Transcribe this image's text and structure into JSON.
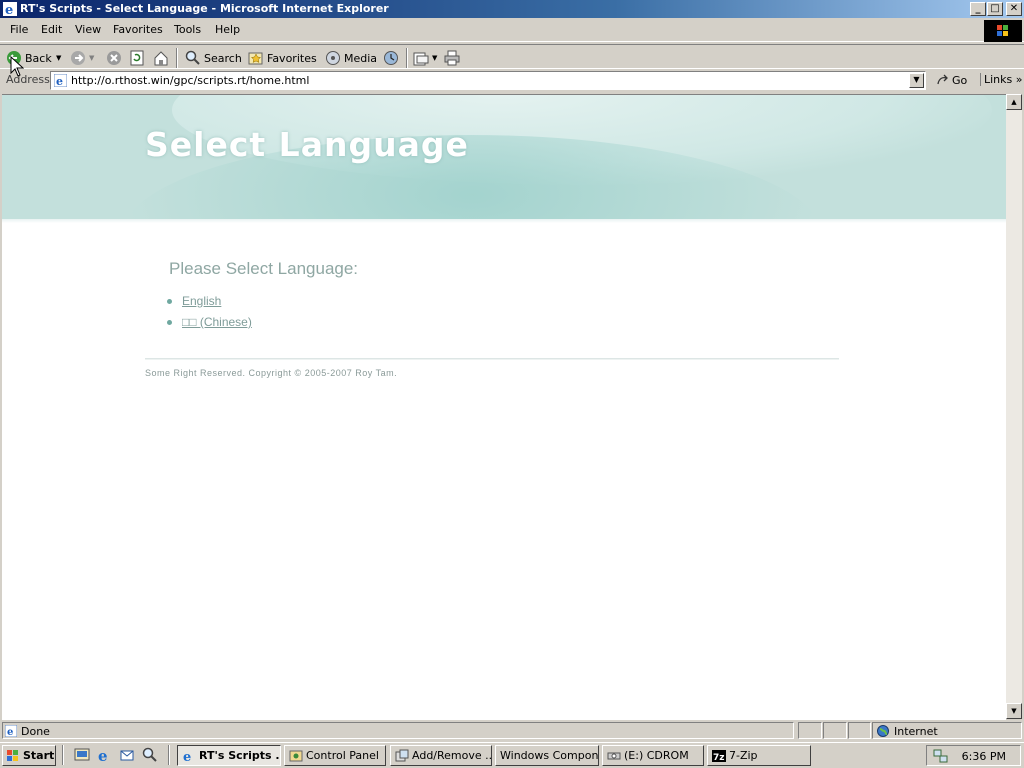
{
  "window": {
    "title": "RT's Scripts - Select Language - Microsoft Internet Explorer"
  },
  "menu": [
    "File",
    "Edit",
    "View",
    "Favorites",
    "Tools",
    "Help"
  ],
  "toolbar": {
    "back": "Back",
    "search": "Search",
    "favorites": "Favorites",
    "media": "Media"
  },
  "address": {
    "label": "Address",
    "url": "http://o.rthost.win/gpc/scripts.rt/home.html",
    "go": "Go",
    "links": "Links"
  },
  "page": {
    "banner_title": "Select Language",
    "heading": "Please Select Language:",
    "languages": [
      "English",
      "□□ (Chinese)"
    ],
    "copyright": "Some Right Reserved. Copyright © 2005-2007 Roy Tam."
  },
  "status": {
    "text": "Done",
    "zone": "Internet"
  },
  "taskbar": {
    "start": "Start",
    "tasks": [
      "RT's Scripts ...",
      "Control Panel",
      "Add/Remove ...",
      "Windows Compon...",
      "(E:) CDROM",
      "7-Zip"
    ],
    "clock": "6:36 PM"
  },
  "colors": {
    "banner": "#c3e0dc",
    "heading": "#8fa7a3",
    "link": "#7f9c99",
    "titlebar_start": "#0a246a"
  }
}
